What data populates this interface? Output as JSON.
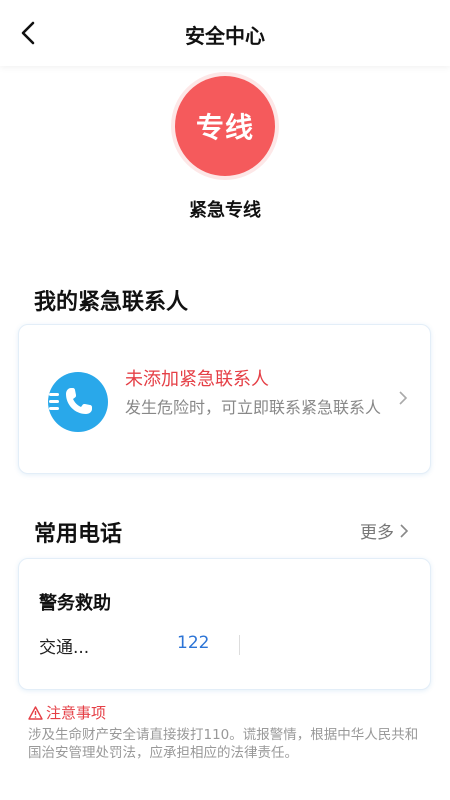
{
  "header": {
    "title": "安全中心"
  },
  "hotline": {
    "circle_text": "专线",
    "label": "紧急专线",
    "color": "#f55a5c"
  },
  "contacts": {
    "section_title": "我的紧急联系人",
    "empty_title": "未添加紧急联系人",
    "empty_desc": "发生危险时，可立即联系紧急联系人"
  },
  "phones": {
    "section_title": "常用电话",
    "more_label": "更多",
    "group_title": "警务救助",
    "items": [
      {
        "name": "交通...",
        "number": "122"
      }
    ]
  },
  "notice": {
    "title": "注意事项",
    "text": "涉及生命财产安全请直接拨打110。谎报警情，根据中华人民共和国治安管理处罚法，应承担相应的法律责任。"
  },
  "colors": {
    "accent_red": "#e53f46",
    "link_blue": "#2c74d6",
    "icon_blue": "#29a8ea"
  }
}
